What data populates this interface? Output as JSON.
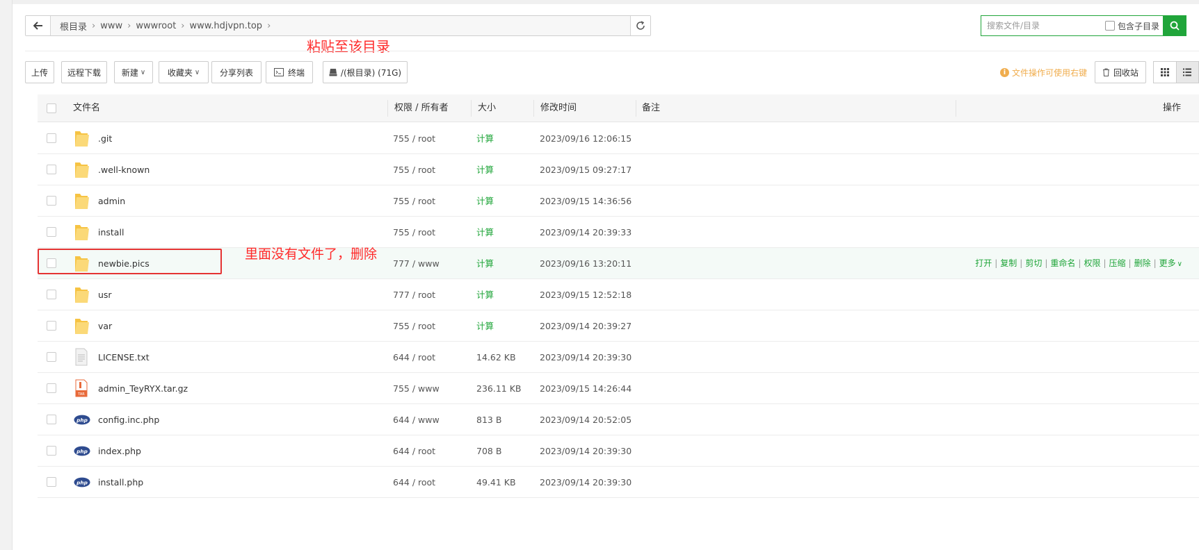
{
  "breadcrumb": [
    "根目录",
    "www",
    "wwwroot",
    "www.hdjvpn.top"
  ],
  "search": {
    "placeholder": "搜索文件/目录",
    "include_sub_label": "包含子目录"
  },
  "annotation_top": "粘贴至该目录",
  "annotation_row": "里面没有文件了，删除",
  "toolbar": {
    "upload": "上传",
    "remote_download": "远程下载",
    "new": "新建",
    "favorites": "收藏夹",
    "share_list": "分享列表",
    "terminal": "终端",
    "disk": "/(根目录) (71G)",
    "tip": "文件操作可使用右键",
    "recycle": "回收站"
  },
  "columns": {
    "name": "文件名",
    "perm": "权限 / 所有者",
    "size": "大小",
    "mtime": "修改时间",
    "note": "备注",
    "ops": "操作"
  },
  "row_ops": [
    "打开",
    "复制",
    "剪切",
    "重命名",
    "权限",
    "压缩",
    "删除",
    "更多"
  ],
  "files": [
    {
      "name": ".git",
      "type": "folder",
      "perm": "755 / root",
      "size": "计算",
      "mtime": "2023/09/16 12:06:15"
    },
    {
      "name": ".well-known",
      "type": "folder",
      "perm": "755 / root",
      "size": "计算",
      "mtime": "2023/09/15 09:27:17"
    },
    {
      "name": "admin",
      "type": "folder",
      "perm": "755 / root",
      "size": "计算",
      "mtime": "2023/09/15 14:36:56"
    },
    {
      "name": "install",
      "type": "folder",
      "perm": "755 / root",
      "size": "计算",
      "mtime": "2023/09/14 20:39:33"
    },
    {
      "name": "newbie.pics",
      "type": "folder",
      "perm": "777 / www",
      "size": "计算",
      "mtime": "2023/09/16 13:20:11",
      "highlight": true
    },
    {
      "name": "usr",
      "type": "folder",
      "perm": "777 / root",
      "size": "计算",
      "mtime": "2023/09/15 12:52:18"
    },
    {
      "name": "var",
      "type": "folder",
      "perm": "755 / root",
      "size": "计算",
      "mtime": "2023/09/14 20:39:27"
    },
    {
      "name": "LICENSE.txt",
      "type": "txt",
      "perm": "644 / root",
      "size": "14.62 KB",
      "mtime": "2023/09/14 20:39:30"
    },
    {
      "name": "admin_TeyRYX.tar.gz",
      "type": "tar",
      "perm": "755 / www",
      "size": "236.11 KB",
      "mtime": "2023/09/15 14:26:44"
    },
    {
      "name": "config.inc.php",
      "type": "php",
      "perm": "644 / www",
      "size": "813 B",
      "mtime": "2023/09/14 20:52:05"
    },
    {
      "name": "index.php",
      "type": "php",
      "perm": "644 / root",
      "size": "708 B",
      "mtime": "2023/09/14 20:39:30"
    },
    {
      "name": "install.php",
      "type": "php",
      "perm": "644 / root",
      "size": "49.41 KB",
      "mtime": "2023/09/14 20:39:30"
    }
  ],
  "colors": {
    "accent": "#20a53a",
    "annotation": "#ff2a2a",
    "tip": "#f0ad4e"
  }
}
